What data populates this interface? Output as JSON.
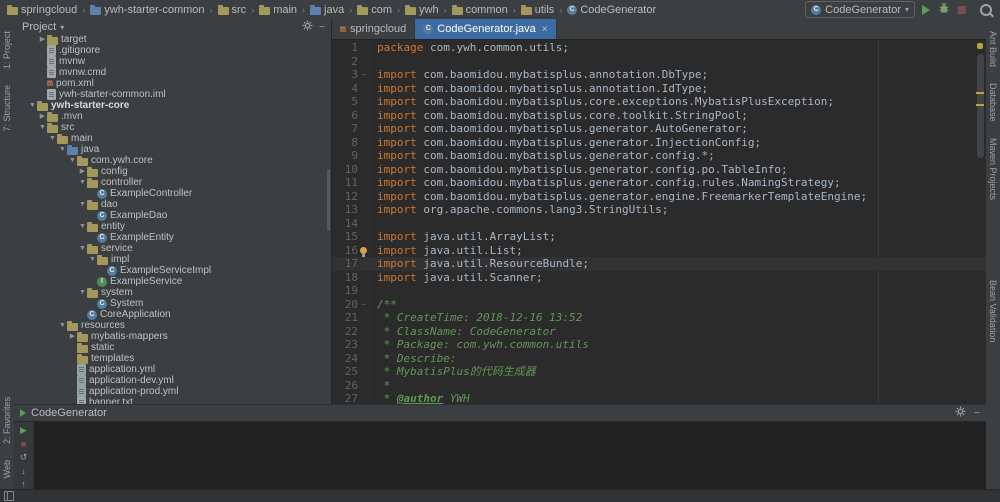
{
  "colors": {
    "panel_bg": "#3c3f41",
    "editor_bg": "#2b2b2b",
    "active_tab": "#3d6ba3",
    "keyword": "#cc7832",
    "comment": "#629755",
    "caret_line": "#323232"
  },
  "top_bar": {
    "breadcrumbs": [
      {
        "label": "springcloud",
        "icon": "folder"
      },
      {
        "label": "ywh-starter-common",
        "icon": "folder-blue"
      },
      {
        "label": "src",
        "icon": "folder"
      },
      {
        "label": "main",
        "icon": "folder"
      },
      {
        "label": "java",
        "icon": "folder-blue"
      },
      {
        "label": "com",
        "icon": "folder"
      },
      {
        "label": "ywh",
        "icon": "folder"
      },
      {
        "label": "common",
        "icon": "folder"
      },
      {
        "label": "utils",
        "icon": "folder"
      },
      {
        "label": "CodeGenerator",
        "icon": "class"
      }
    ],
    "run_config": "CodeGenerator",
    "actions": [
      "run",
      "debug",
      "stop",
      "search"
    ]
  },
  "left_stripe": {
    "top": [
      "1: Project",
      "7: Structure"
    ],
    "bottom": [
      "2: Favorites",
      "Web"
    ]
  },
  "right_stripe": [
    "Ant Build",
    "Database",
    "Maven Projects",
    "Bean Validation"
  ],
  "project_panel": {
    "title": "Project",
    "tree": [
      {
        "label": "target",
        "icon": "folder",
        "depth": 2,
        "arrow": "closed"
      },
      {
        "label": ".gitignore",
        "icon": "file",
        "depth": 2,
        "arrow": "none"
      },
      {
        "label": "mvnw",
        "icon": "file",
        "depth": 2,
        "arrow": "none"
      },
      {
        "label": "mvnw.cmd",
        "icon": "file",
        "depth": 2,
        "arrow": "none"
      },
      {
        "label": "pom.xml",
        "icon": "maven",
        "depth": 2,
        "arrow": "none"
      },
      {
        "label": "ywh-starter-common.iml",
        "icon": "file",
        "depth": 2,
        "arrow": "none"
      },
      {
        "label": "ywh-starter-core",
        "icon": "folder",
        "depth": 1,
        "arrow": "open",
        "bold": true
      },
      {
        "label": ".mvn",
        "icon": "folder",
        "depth": 2,
        "arrow": "closed"
      },
      {
        "label": "src",
        "icon": "folder",
        "depth": 2,
        "arrow": "open"
      },
      {
        "label": "main",
        "icon": "folder",
        "depth": 3,
        "arrow": "open"
      },
      {
        "label": "java",
        "icon": "folder-blue",
        "depth": 4,
        "arrow": "open"
      },
      {
        "label": "com.ywh.core",
        "icon": "folder",
        "depth": 5,
        "arrow": "open"
      },
      {
        "label": "config",
        "icon": "folder",
        "depth": 6,
        "arrow": "closed"
      },
      {
        "label": "controller",
        "icon": "folder",
        "depth": 6,
        "arrow": "open"
      },
      {
        "label": "ExampleController",
        "icon": "class",
        "depth": 7,
        "arrow": "none"
      },
      {
        "label": "dao",
        "icon": "folder",
        "depth": 6,
        "arrow": "open"
      },
      {
        "label": "ExampleDao",
        "icon": "class",
        "depth": 7,
        "arrow": "none"
      },
      {
        "label": "entity",
        "icon": "folder",
        "depth": 6,
        "arrow": "open"
      },
      {
        "label": "ExampleEntity",
        "icon": "class",
        "depth": 7,
        "arrow": "none"
      },
      {
        "label": "service",
        "icon": "folder",
        "depth": 6,
        "arrow": "open"
      },
      {
        "label": "impl",
        "icon": "folder",
        "depth": 7,
        "arrow": "open"
      },
      {
        "label": "ExampleServiceImpl",
        "icon": "class",
        "depth": 8,
        "arrow": "none"
      },
      {
        "label": "ExampleService",
        "icon": "interface",
        "depth": 7,
        "arrow": "none"
      },
      {
        "label": "system",
        "icon": "folder",
        "depth": 6,
        "arrow": "open"
      },
      {
        "label": "System",
        "icon": "class",
        "depth": 7,
        "arrow": "none"
      },
      {
        "label": "CoreApplication",
        "icon": "class",
        "depth": 6,
        "arrow": "none"
      },
      {
        "label": "resources",
        "icon": "folder",
        "depth": 4,
        "arrow": "open"
      },
      {
        "label": "mybatis-mappers",
        "icon": "folder",
        "depth": 5,
        "arrow": "closed"
      },
      {
        "label": "static",
        "icon": "folder",
        "depth": 5,
        "arrow": "none"
      },
      {
        "label": "templates",
        "icon": "folder",
        "depth": 5,
        "arrow": "none"
      },
      {
        "label": "application.yml",
        "icon": "yml",
        "depth": 5,
        "arrow": "none"
      },
      {
        "label": "application-dev.yml",
        "icon": "yml",
        "depth": 5,
        "arrow": "none"
      },
      {
        "label": "application-prod.yml",
        "icon": "yml",
        "depth": 5,
        "arrow": "none"
      },
      {
        "label": "banner.txt",
        "icon": "file",
        "depth": 5,
        "arrow": "none"
      }
    ]
  },
  "editor": {
    "tabs": [
      {
        "label": "springcloud",
        "icon": "maven",
        "active": false,
        "close": false
      },
      {
        "label": "CodeGenerator.java",
        "icon": "class",
        "active": true,
        "close": true
      }
    ],
    "lines": [
      {
        "n": 1,
        "seg": [
          [
            "kw",
            "package"
          ],
          [
            "pl",
            " com.ywh.common.utils;"
          ]
        ]
      },
      {
        "n": 2,
        "seg": []
      },
      {
        "n": 3,
        "fold": true,
        "seg": [
          [
            "kw",
            "import"
          ],
          [
            "pl",
            " com.baomidou.mybatisplus.annotation.DbType;"
          ]
        ]
      },
      {
        "n": 4,
        "seg": [
          [
            "kw",
            "import"
          ],
          [
            "pl",
            " com.baomidou.mybatisplus.annotation.IdType;"
          ]
        ]
      },
      {
        "n": 5,
        "seg": [
          [
            "kw",
            "import"
          ],
          [
            "pl",
            " com.baomidou.mybatisplus.core.exceptions.MybatisPlusException;"
          ]
        ]
      },
      {
        "n": 6,
        "seg": [
          [
            "kw",
            "import"
          ],
          [
            "pl",
            " com.baomidou.mybatisplus.core.toolkit.StringPool;"
          ]
        ]
      },
      {
        "n": 7,
        "seg": [
          [
            "kw",
            "import"
          ],
          [
            "pl",
            " com.baomidou.mybatisplus.generator.AutoGenerator;"
          ]
        ]
      },
      {
        "n": 8,
        "seg": [
          [
            "kw",
            "import"
          ],
          [
            "pl",
            " com.baomidou.mybatisplus.generator.InjectionConfig;"
          ]
        ]
      },
      {
        "n": 9,
        "seg": [
          [
            "kw",
            "import"
          ],
          [
            "pl",
            " com.baomidou.mybatisplus.generator.config.*;"
          ]
        ]
      },
      {
        "n": 10,
        "seg": [
          [
            "kw",
            "import"
          ],
          [
            "pl",
            " com.baomidou.mybatisplus.generator.config.po.TableInfo;"
          ]
        ]
      },
      {
        "n": 11,
        "seg": [
          [
            "kw",
            "import"
          ],
          [
            "pl",
            " com.baomidou.mybatisplus.generator.config.rules.NamingStrategy;"
          ]
        ]
      },
      {
        "n": 12,
        "seg": [
          [
            "kw",
            "import"
          ],
          [
            "pl",
            " com.baomidou.mybatisplus.generator.engine.FreemarkerTemplateEngine;"
          ]
        ]
      },
      {
        "n": 13,
        "seg": [
          [
            "kw",
            "import"
          ],
          [
            "pl",
            " org.apache.commons.lang3.StringUtils;"
          ]
        ]
      },
      {
        "n": 14,
        "seg": []
      },
      {
        "n": 15,
        "seg": [
          [
            "kw",
            "import"
          ],
          [
            "pl",
            " java.util.ArrayList;"
          ]
        ]
      },
      {
        "n": 16,
        "bulb": true,
        "seg": [
          [
            "kw",
            "import"
          ],
          [
            "pl",
            " java.util.List;"
          ]
        ]
      },
      {
        "n": 17,
        "caret": true,
        "seg": [
          [
            "kw",
            "import"
          ],
          [
            "pl",
            " java.util.ResourceBundle;"
          ]
        ]
      },
      {
        "n": 18,
        "seg": [
          [
            "kw",
            "import"
          ],
          [
            "pl",
            " java.util.Scanner;"
          ]
        ]
      },
      {
        "n": 19,
        "seg": []
      },
      {
        "n": 20,
        "fold": true,
        "seg": [
          [
            "cm",
            "/**"
          ]
        ]
      },
      {
        "n": 21,
        "seg": [
          [
            "cm",
            " * CreateTime: 2018-12-16 13:52"
          ]
        ]
      },
      {
        "n": 22,
        "seg": [
          [
            "cm",
            " * ClassName: CodeGenerator"
          ]
        ]
      },
      {
        "n": 23,
        "seg": [
          [
            "cm",
            " * Package: com.ywh.common.utils"
          ]
        ]
      },
      {
        "n": 24,
        "seg": [
          [
            "cm",
            " * Describe:"
          ]
        ]
      },
      {
        "n": 25,
        "seg": [
          [
            "cm",
            " * MybatisPlus的代码生成器"
          ]
        ]
      },
      {
        "n": 26,
        "seg": [
          [
            "cm",
            " *"
          ]
        ]
      },
      {
        "n": 27,
        "seg": [
          [
            "cm",
            " * "
          ],
          [
            "tag",
            "@author"
          ],
          [
            "cm",
            " YWH"
          ]
        ]
      }
    ]
  },
  "run_panel": {
    "tab_label": "CodeGenerator",
    "toolbar": [
      {
        "name": "rerun-button",
        "glyph": "▶",
        "style": "green"
      },
      {
        "name": "stop-button",
        "glyph": "■",
        "style": "red"
      },
      {
        "name": "restore-layout-button",
        "glyph": "↺",
        "style": ""
      },
      {
        "name": "scroll-down-button",
        "glyph": "↓",
        "style": ""
      },
      {
        "name": "scroll-up-button",
        "glyph": "↑",
        "style": ""
      },
      {
        "name": "console-menu-button",
        "glyph": "≡",
        "style": ""
      }
    ]
  }
}
